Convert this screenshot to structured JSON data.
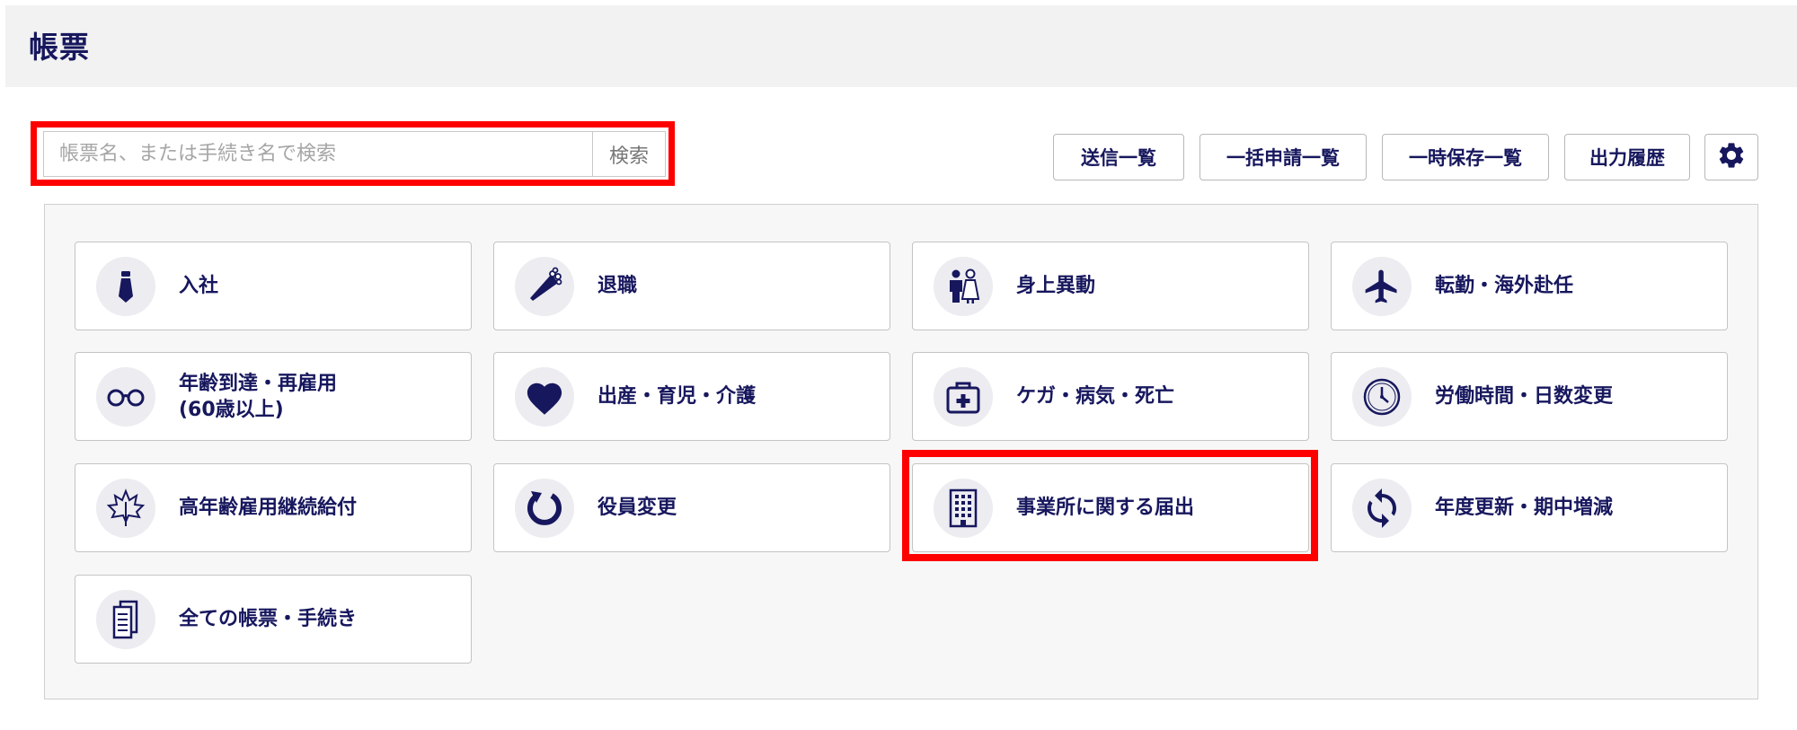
{
  "header": {
    "title": "帳票"
  },
  "search": {
    "placeholder": "帳票名、または手続き名で検索",
    "value": "",
    "button_label": "検索"
  },
  "toolbar": {
    "buttons": [
      {
        "label": "送信一覧"
      },
      {
        "label": "一括申請一覧"
      },
      {
        "label": "一時保存一覧"
      },
      {
        "label": "出力履歴"
      }
    ],
    "settings_icon": "gear-icon"
  },
  "categories": [
    {
      "label": "入社",
      "icon": "necktie-icon"
    },
    {
      "label": "退職",
      "icon": "bouquet-icon"
    },
    {
      "label": "身上異動",
      "icon": "wedding-couple-icon"
    },
    {
      "label": "転勤・海外赴任",
      "icon": "airplane-icon"
    },
    {
      "label_line1": "年齢到達・再雇用",
      "label_line2": "(60歳以上)",
      "icon": "glasses-icon"
    },
    {
      "label": "出産・育児・介護",
      "icon": "heart-icon"
    },
    {
      "label": "ケガ・病気・死亡",
      "icon": "medical-kit-icon"
    },
    {
      "label": "労働時間・日数変更",
      "icon": "clock-icon"
    },
    {
      "label": "高年齢雇用継続給付",
      "icon": "maple-leaf-icon"
    },
    {
      "label": "役員変更",
      "icon": "rotate-arrow-icon"
    },
    {
      "label": "事業所に関する届出",
      "icon": "building-icon"
    },
    {
      "label": "年度更新・期中増減",
      "icon": "sync-icon"
    },
    {
      "label": "全ての帳票・手続き",
      "icon": "documents-icon"
    }
  ],
  "colors": {
    "text": "#17175e",
    "highlight": "#ff0000",
    "header_bg": "#f2f2f2",
    "panel_bg": "#f7f7f7"
  }
}
